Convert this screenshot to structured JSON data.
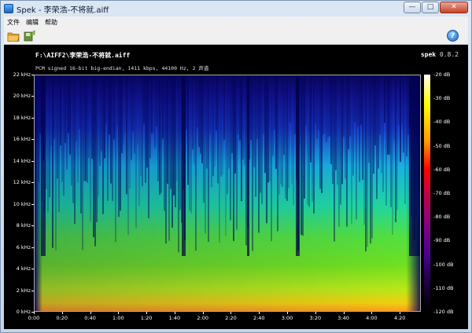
{
  "window": {
    "title": "Spek - 李荣浩-不将就.aiff",
    "buttons": {
      "minimize": "—",
      "maximize": "□",
      "close": "✕"
    }
  },
  "menu": {
    "items": [
      "文件",
      "编辑",
      "帮助"
    ]
  },
  "toolbar": {
    "open_icon": "open-folder-icon",
    "save_icon": "save-icon",
    "help_icon": "help-icon",
    "help_glyph": "?"
  },
  "spek": {
    "file_path": "F:\\AIFF2\\李荣浩-不将就.aiff",
    "file_info": "PCM signed 16-bit big-endian, 1411 kbps, 44100 Hz, 2 声道",
    "brand_name": "spek",
    "brand_version": "0.8.2"
  },
  "chart_data": {
    "type": "heatmap",
    "y_axis_labels": [
      "22 kHz",
      "20 kHz",
      "18 kHz",
      "16 kHz",
      "14 kHz",
      "12 kHz",
      "10 kHz",
      "8 kHz",
      "6 kHz",
      "4 kHz",
      "2 kHz",
      "0 kHz"
    ],
    "y_values_khz": [
      22,
      20,
      18,
      16,
      14,
      12,
      10,
      8,
      6,
      4,
      2,
      0
    ],
    "ylim": [
      0,
      22
    ],
    "x_axis_labels": [
      "0:00",
      "0:20",
      "0:40",
      "1:00",
      "1:20",
      "1:40",
      "2:00",
      "2:20",
      "2:40",
      "3:00",
      "3:20",
      "3:40",
      "4:00",
      "4:20"
    ],
    "x_values_sec": [
      0,
      20,
      40,
      60,
      80,
      100,
      120,
      140,
      160,
      180,
      200,
      220,
      240,
      260
    ],
    "xlim": [
      0,
      275
    ],
    "db_labels": [
      "-20 dB",
      "-30 dB",
      "-40 dB",
      "-50 dB",
      "-60 dB",
      "-70 dB",
      "-80 dB",
      "-90 dB",
      "-100 dB",
      "-110 dB",
      "-120 dB"
    ],
    "db_values": [
      -20,
      -30,
      -40,
      -50,
      -60,
      -70,
      -80,
      -90,
      -100,
      -110,
      -120
    ],
    "db_range": [
      -120,
      -20
    ]
  },
  "colors": {
    "panel_bg": "#000000",
    "axis": "#ffffff"
  }
}
